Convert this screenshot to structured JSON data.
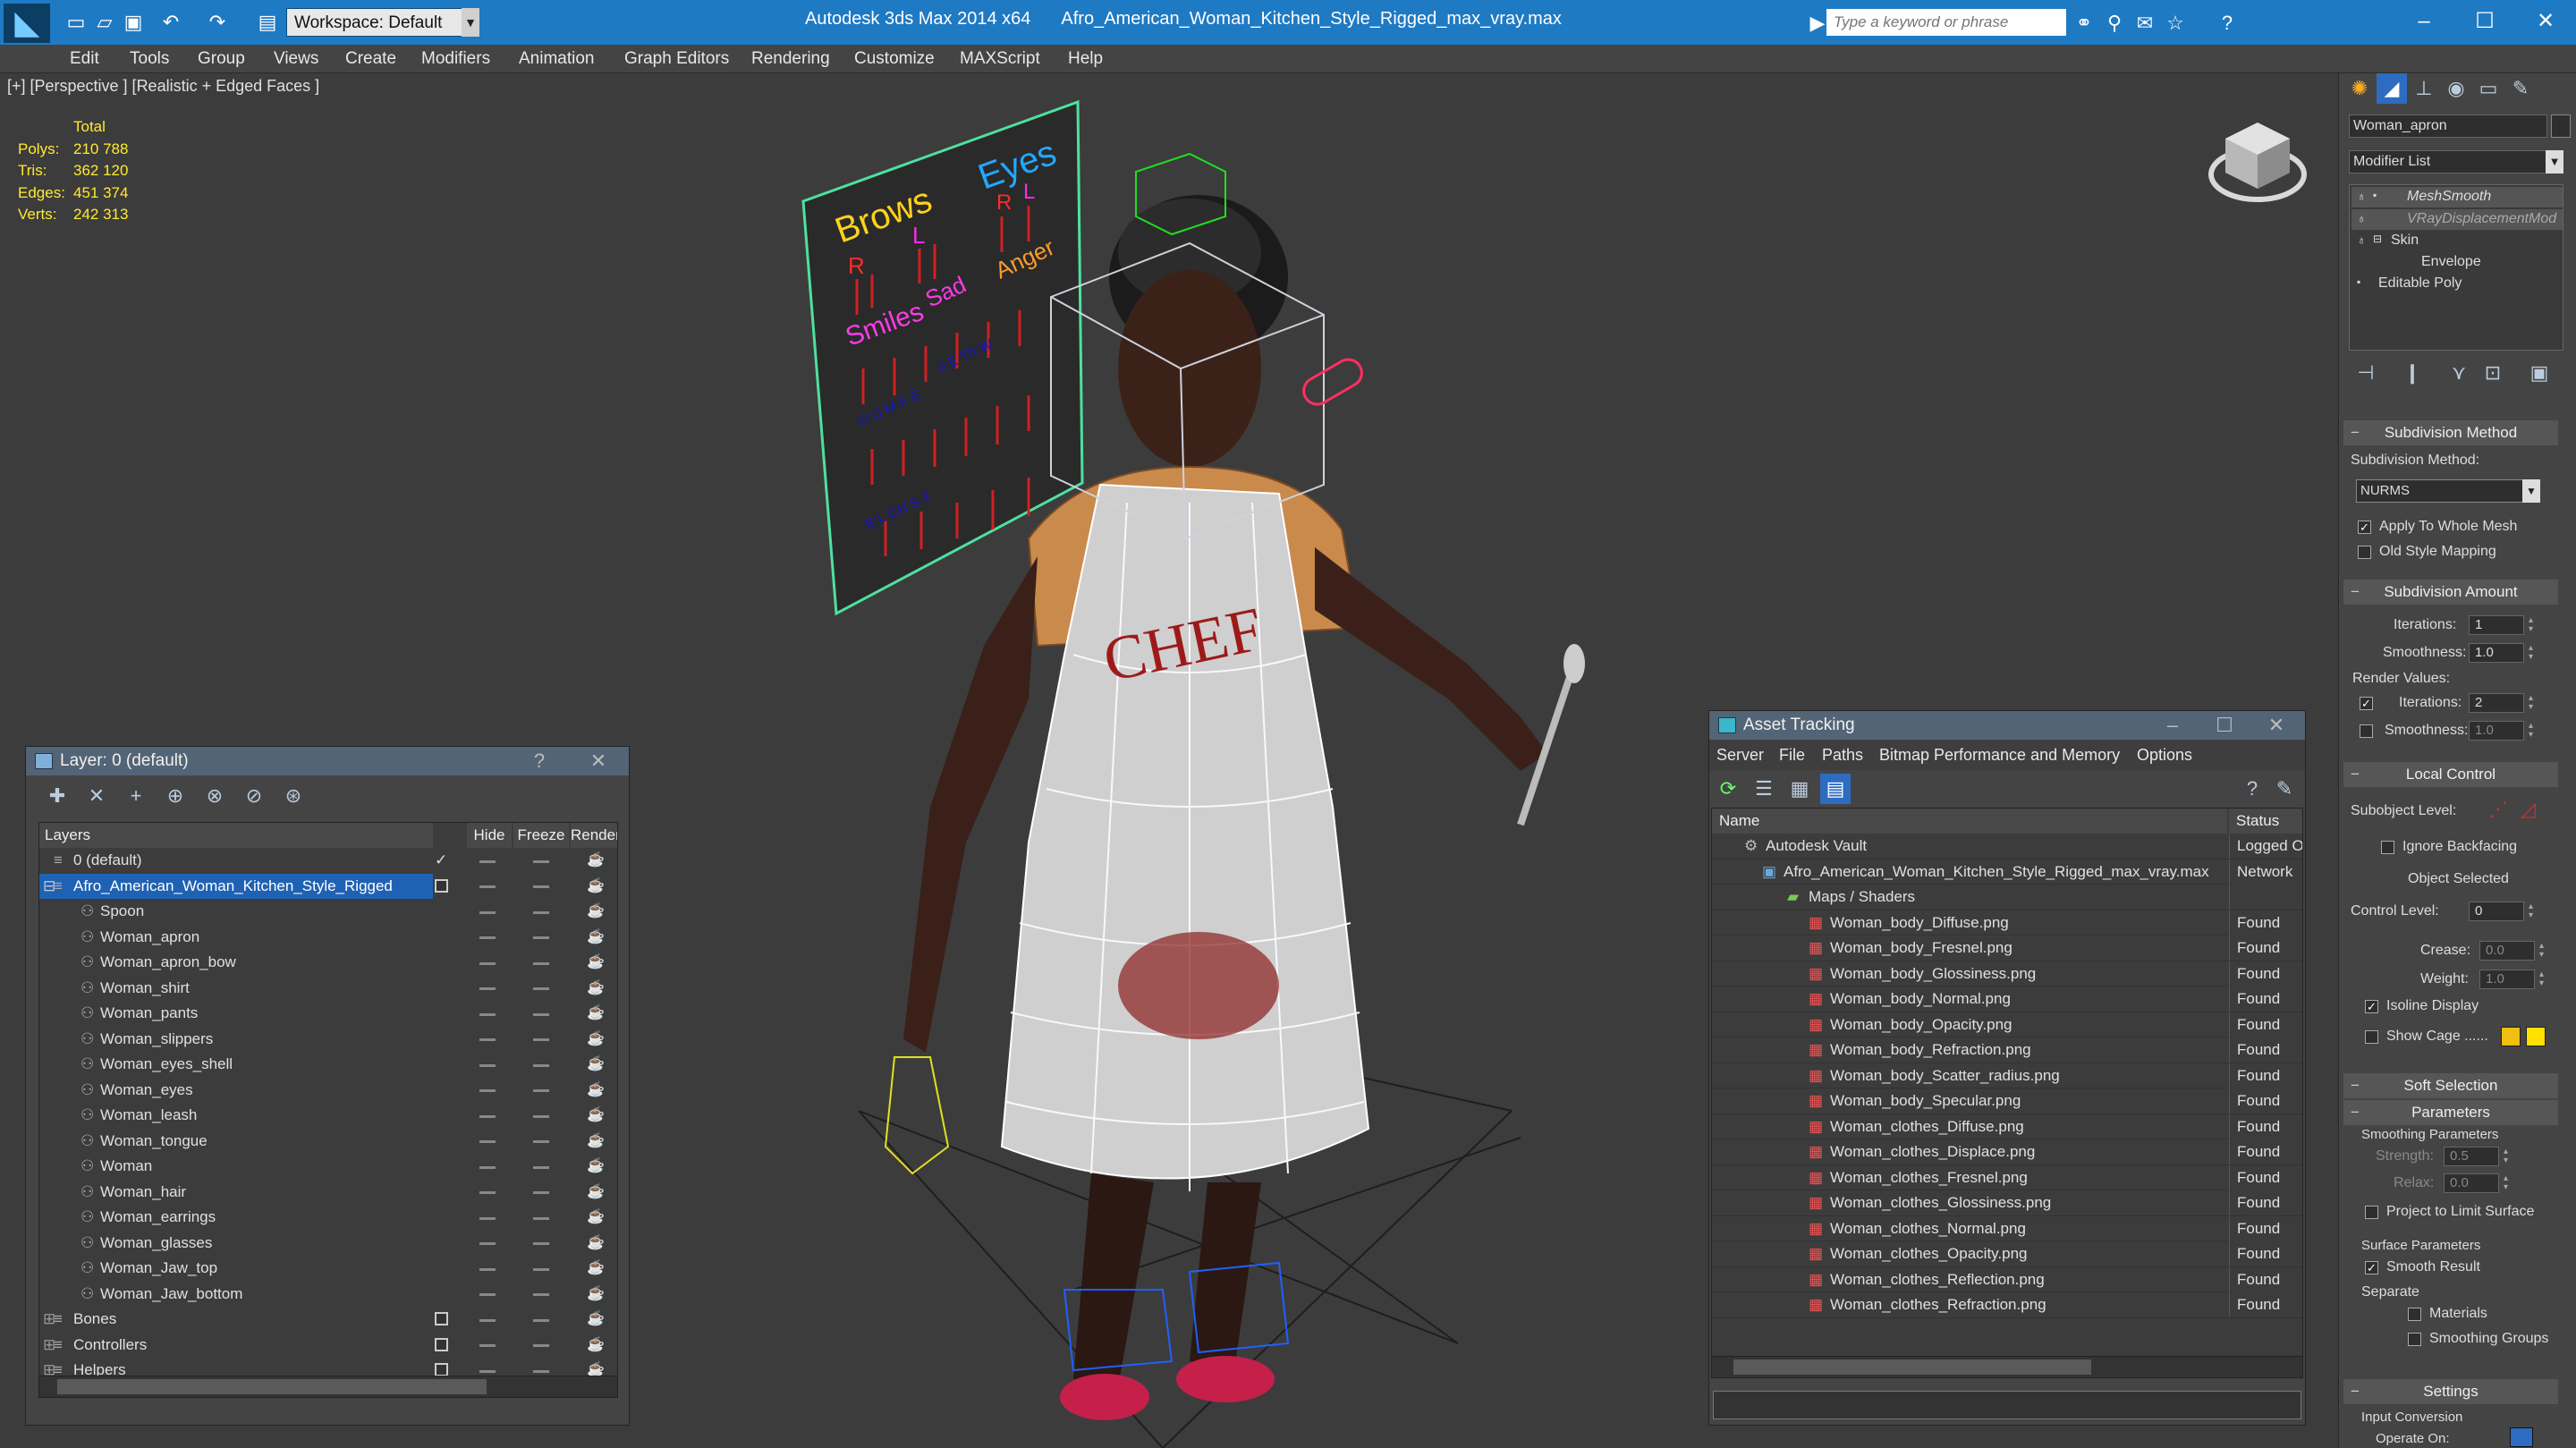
{
  "titlebar": {
    "app_title": "Autodesk 3ds Max  2014 x64",
    "file_title": "Afro_American_Woman_Kitchen_Style_Rigged_max_vray.max",
    "workspace": "Workspace: Default",
    "search_placeholder": "Type a keyword or phrase"
  },
  "menu": [
    "Edit",
    "Tools",
    "Group",
    "Views",
    "Create",
    "Modifiers",
    "Animation",
    "Graph Editors",
    "Rendering",
    "Customize",
    "MAXScript",
    "Help"
  ],
  "viewport": {
    "label": "[+] [Perspective ] [Realistic + Edged Faces ]",
    "stats": {
      "header": "Total",
      "rows": [
        {
          "label": "Polys:",
          "value": "210 788"
        },
        {
          "label": "Tris:",
          "value": "362 120"
        },
        {
          "label": "Edges:",
          "value": "451 374"
        },
        {
          "label": "Verts:",
          "value": "242 313"
        }
      ]
    },
    "board": {
      "brows": "Brows",
      "eyes": "Eyes",
      "smiles": "Smiles",
      "angry": "Anger",
      "sad": "Sad",
      "r": "R",
      "l": "L"
    }
  },
  "layer_panel": {
    "title": "Layer: 0 (default)",
    "columns": {
      "layers": "Layers",
      "hide": "Hide",
      "freeze": "Freeze",
      "render": "Render"
    },
    "rows": [
      {
        "name": "0 (default)",
        "level": 1
      },
      {
        "name": "Afro_American_Woman_Kitchen_Style_Rigged",
        "level": 1,
        "selected": true
      },
      {
        "name": "Spoon",
        "level": 2
      },
      {
        "name": "Woman_apron",
        "level": 2
      },
      {
        "name": "Woman_apron_bow",
        "level": 2
      },
      {
        "name": "Woman_shirt",
        "level": 2
      },
      {
        "name": "Woman_pants",
        "level": 2
      },
      {
        "name": "Woman_slippers",
        "level": 2
      },
      {
        "name": "Woman_eyes_shell",
        "level": 2
      },
      {
        "name": "Woman_eyes",
        "level": 2
      },
      {
        "name": "Woman_leash",
        "level": 2
      },
      {
        "name": "Woman_tongue",
        "level": 2
      },
      {
        "name": "Woman",
        "level": 2
      },
      {
        "name": "Woman_hair",
        "level": 2
      },
      {
        "name": "Woman_earrings",
        "level": 2
      },
      {
        "name": "Woman_glasses",
        "level": 2
      },
      {
        "name": "Woman_Jaw_top",
        "level": 2
      },
      {
        "name": "Woman_Jaw_bottom",
        "level": 2
      },
      {
        "name": "Bones",
        "level": 1
      },
      {
        "name": "Controllers",
        "level": 1
      },
      {
        "name": "Helpers",
        "level": 1
      }
    ]
  },
  "asset_panel": {
    "title": "Asset Tracking",
    "menu": [
      "Server",
      "File",
      "Paths",
      "Bitmap Performance and Memory",
      "Options"
    ],
    "columns": {
      "name": "Name",
      "status": "Status"
    },
    "rows": [
      {
        "name": "Autodesk Vault",
        "status": "Logged O",
        "level": 0
      },
      {
        "name": "Afro_American_Woman_Kitchen_Style_Rigged_max_vray.max",
        "status": "Network",
        "level": 1
      },
      {
        "name": "Maps / Shaders",
        "status": "",
        "level": 2
      },
      {
        "name": "Woman_body_Diffuse.png",
        "status": "Found",
        "level": 3
      },
      {
        "name": "Woman_body_Fresnel.png",
        "status": "Found",
        "level": 3
      },
      {
        "name": "Woman_body_Glossiness.png",
        "status": "Found",
        "level": 3
      },
      {
        "name": "Woman_body_Normal.png",
        "status": "Found",
        "level": 3
      },
      {
        "name": "Woman_body_Opacity.png",
        "status": "Found",
        "level": 3
      },
      {
        "name": "Woman_body_Refraction.png",
        "status": "Found",
        "level": 3
      },
      {
        "name": "Woman_body_Scatter_radius.png",
        "status": "Found",
        "level": 3
      },
      {
        "name": "Woman_body_Specular.png",
        "status": "Found",
        "level": 3
      },
      {
        "name": "Woman_clothes_Diffuse.png",
        "status": "Found",
        "level": 3
      },
      {
        "name": "Woman_clothes_Displace.png",
        "status": "Found",
        "level": 3
      },
      {
        "name": "Woman_clothes_Fresnel.png",
        "status": "Found",
        "level": 3
      },
      {
        "name": "Woman_clothes_Glossiness.png",
        "status": "Found",
        "level": 3
      },
      {
        "name": "Woman_clothes_Normal.png",
        "status": "Found",
        "level": 3
      },
      {
        "name": "Woman_clothes_Opacity.png",
        "status": "Found",
        "level": 3
      },
      {
        "name": "Woman_clothes_Reflection.png",
        "status": "Found",
        "level": 3
      },
      {
        "name": "Woman_clothes_Refraction.png",
        "status": "Found",
        "level": 3
      }
    ]
  },
  "command_panel": {
    "object_name": "Woman_apron",
    "modifier_list": "Modifier List",
    "stack": [
      "MeshSmooth",
      "VRayDisplacementMod",
      "Skin",
      "Envelope",
      "Editable Poly"
    ],
    "subdivision_method": {
      "title": "Subdivision Method",
      "label": "Subdivision Method:",
      "value": "NURMS",
      "apply_whole": "Apply To Whole Mesh",
      "old_style": "Old Style Mapping"
    },
    "subdivision_amount": {
      "title": "Subdivision Amount",
      "iterations_label": "Iterations:",
      "iterations": "1",
      "smoothness_label": "Smoothness:",
      "smoothness": "1.0",
      "render_values": "Render Values:",
      "r_iterations": "2",
      "r_smoothness": "1.0"
    },
    "local_control": {
      "title": "Local Control",
      "subobject_level": "Subobject Level:",
      "ignore_backfacing": "Ignore Backfacing",
      "object_selected": "Object Selected",
      "control_level_label": "Control Level:",
      "control_level": "0",
      "crease_label": "Crease:",
      "crease": "0.0",
      "weight_label": "Weight:",
      "weight": "1.0",
      "isoline": "Isoline Display",
      "show_cage": "Show Cage ......"
    },
    "soft_selection": "Soft Selection",
    "parameters": {
      "title": "Parameters",
      "smoothing_params": "Smoothing Parameters",
      "strength_label": "Strength:",
      "strength": "0.5",
      "relax_label": "Relax:",
      "relax": "0.0",
      "project": "Project to Limit Surface",
      "surface_params": "Surface Parameters",
      "smooth_result": "Smooth Result",
      "separate": "Separate",
      "materials": "Materials",
      "smoothing_groups": "Smoothing Groups"
    },
    "settings": {
      "title": "Settings",
      "input_conversion": "Input Conversion",
      "operate_on": "Operate On:"
    }
  },
  "colors": {
    "accent": "#1f7ac4",
    "selection": "#1f62b4",
    "stats": "#ffea30",
    "cage1": "#f0c010",
    "cage2": "#ffe000"
  }
}
